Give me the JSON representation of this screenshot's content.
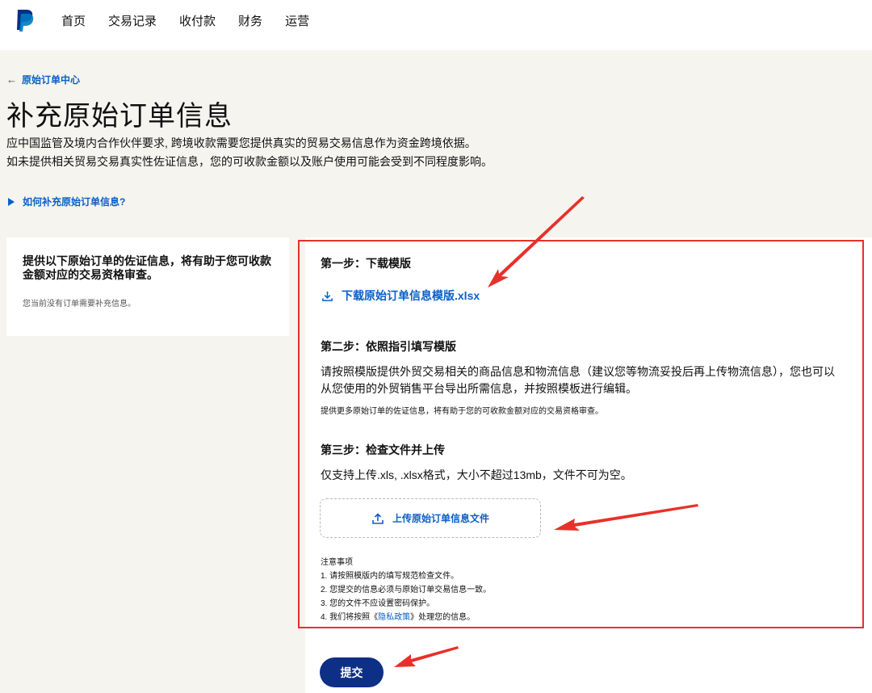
{
  "nav": {
    "items": [
      "首页",
      "交易记录",
      "收付款",
      "财务",
      "运营"
    ]
  },
  "breadcrumb": {
    "back_label": "原始订单中心",
    "arrow": "←"
  },
  "page": {
    "title": "补充原始订单信息",
    "desc_line1": "应中国监管及境内合作伙伴要求, 跨境收款需要您提供真实的贸易交易信息作为资金跨境依据。",
    "desc_line2": "如未提供相关贸易交易真实性佐证信息，您的可收款金额以及账户使用可能会受到不同程度影响。",
    "howto_link": "如何补充原始订单信息?"
  },
  "left_card": {
    "heading": "提供以下原始订单的佐证信息，将有助于您可收款金额对应的交易资格审查。",
    "status": "您当前没有订单需要补充信息。"
  },
  "steps": {
    "step1_title": "第一步：下载模版",
    "download_link": "下载原始订单信息模版.xlsx",
    "step2_title": "第二步：依照指引填写模版",
    "step2_line1": "请按照模版提供外贸交易相关的商品信息和物流信息（建议您等物流妥投后再上传物流信息），您也可以",
    "step2_line2": "从您使用的外贸销售平台导出所需信息，并按照模板进行编辑。",
    "step2_note": "提供更多原始订单的佐证信息，将有助于您的可收款金额对应的交易资格审查。",
    "step3_title": "第三步：检查文件并上传",
    "step3_desc": "仅支持上传.xls, .xlsx格式，大小不超过13mb，文件不可为空。",
    "upload_label": "上传原始订单信息文件"
  },
  "notes": {
    "heading": "注意事项",
    "item1": "1. 请按照模版内的填写规范检查文件。",
    "item2": "2. 您提交的信息必须与原始订单交易信息一致。",
    "item3": "3. 您的文件不应设置密码保护。",
    "item4_prefix": "4. 我们将按照《",
    "item4_link": "隐私政策",
    "item4_suffix": "》处理您的信息。"
  },
  "submit_label": "提交",
  "colors": {
    "brand_blue": "#0b5fc7",
    "dark_blue": "#0e2f86",
    "annotation_red": "#e8302a",
    "background": "#f5f4ee"
  },
  "icons": {
    "logo": "paypal-logo",
    "download": "download-icon",
    "upload": "upload-icon",
    "expand": "triangle-right-icon"
  }
}
